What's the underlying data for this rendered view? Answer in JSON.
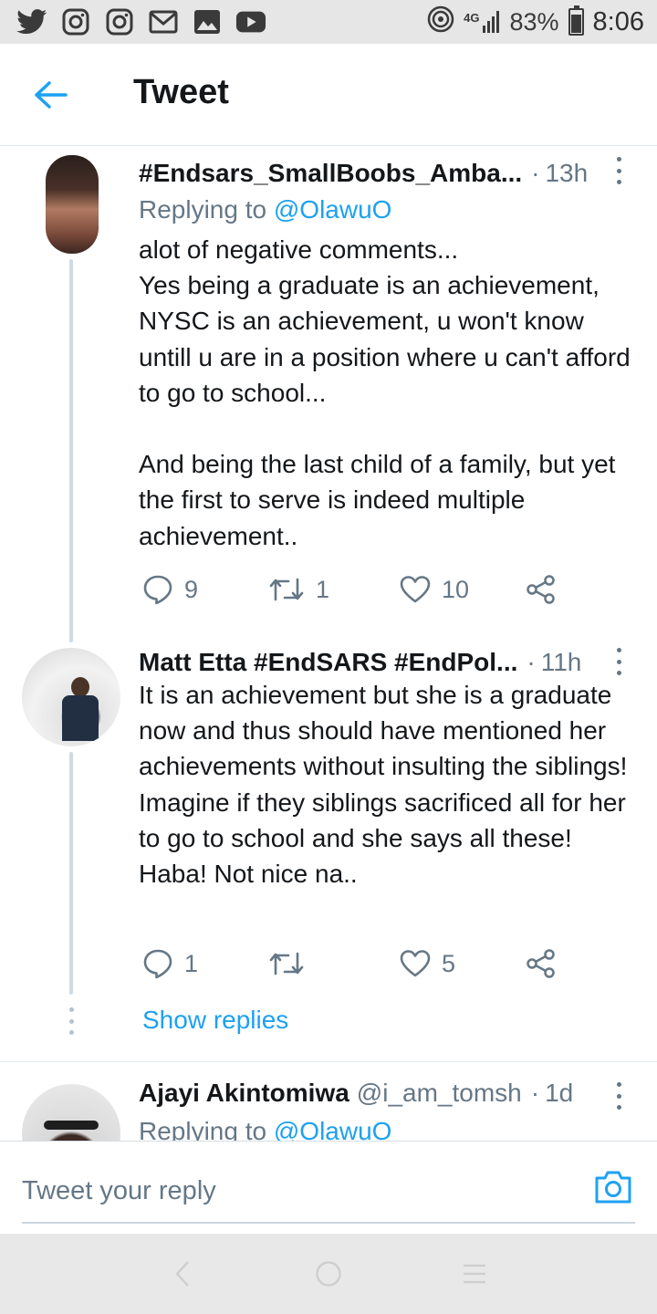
{
  "status_bar": {
    "network": "4G",
    "battery": "83%",
    "time": "8:06",
    "icons": [
      "twitter-icon",
      "instagram-icon",
      "instagram-icon",
      "gmail-icon",
      "gallery-icon",
      "youtube-icon",
      "hotspot-icon",
      "signal-icon",
      "battery-icon"
    ]
  },
  "header": {
    "title": "Tweet",
    "back_icon": "arrow-left-icon",
    "accent_color": "#1da1f2"
  },
  "tweets": [
    {
      "name": "#Endsars_SmallBoobs_Amba...",
      "handle": "",
      "time": "13h",
      "replying_prefix": "Replying to",
      "replying_to": "@OlawuO",
      "text": "alot of negative comments...\nYes being a graduate is an achievement, NYSC is an achievement, u won't know untill u are in a position where u can't afford to go to school...\n\nAnd being the last child of a family, but yet the first to serve is indeed multiple achievement..",
      "replies": "9",
      "retweets": "1",
      "likes": "10"
    },
    {
      "name": "Matt Etta #EndSARS #EndPol...",
      "handle": "",
      "time": "11h",
      "text": "It is an achievement but she is a graduate now and thus should have mentioned her achievements without insulting the siblings! Imagine if they siblings sacrificed all for her to go to school and she says all these! Haba! Not nice na..",
      "replies": "1",
      "retweets": "",
      "likes": "5"
    },
    {
      "name": "Ajayi Akintomiwa",
      "handle": "@i_am_tomsh",
      "time": "1d",
      "replying_prefix": "Replying to",
      "replying_to": "@OlawuO"
    }
  ],
  "show_replies": "Show replies",
  "composer": {
    "placeholder": "Tweet your reply",
    "camera_icon": "camera-icon"
  },
  "nav": {
    "back": "nav-back-icon",
    "home": "nav-home-icon",
    "recents": "nav-recents-icon"
  }
}
